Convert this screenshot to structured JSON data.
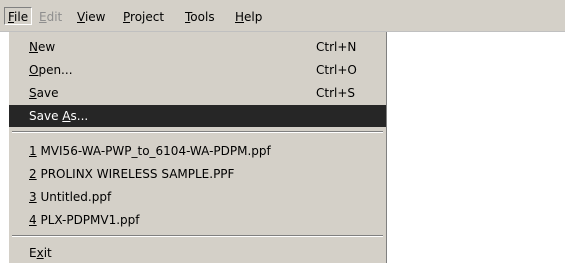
{
  "menubar": {
    "items": [
      {
        "pre": "",
        "key": "F",
        "post": "ile",
        "disabled": false
      },
      {
        "pre": "",
        "key": "E",
        "post": "dit",
        "disabled": true
      },
      {
        "pre": "",
        "key": "V",
        "post": "iew",
        "disabled": false
      },
      {
        "pre": "",
        "key": "P",
        "post": "roject",
        "disabled": false
      },
      {
        "pre": "",
        "key": "T",
        "post": "ools",
        "disabled": false
      },
      {
        "pre": "",
        "key": "H",
        "post": "elp",
        "disabled": false
      }
    ]
  },
  "file_menu": {
    "new": {
      "pre": "",
      "key": "N",
      "post": "ew",
      "shortcut": "Ctrl+N"
    },
    "open": {
      "pre": "",
      "key": "O",
      "post": "pen...",
      "shortcut": "Ctrl+O"
    },
    "save": {
      "pre": "",
      "key": "S",
      "post": "ave",
      "shortcut": "Ctrl+S"
    },
    "save_as": {
      "pre": "Save ",
      "key": "A",
      "post": "s..."
    },
    "recent": [
      {
        "key": "1",
        "post": " MVI56-WA-PWP_to_6104-WA-PDPM.ppf"
      },
      {
        "key": "2",
        "post": " PROLINX WIRELESS SAMPLE.PPF"
      },
      {
        "key": "3",
        "post": " Untitled.ppf"
      },
      {
        "key": "4",
        "post": " PLX-PDPMV1.ppf"
      }
    ],
    "exit": {
      "pre": "E",
      "key": "x",
      "post": "it"
    }
  }
}
